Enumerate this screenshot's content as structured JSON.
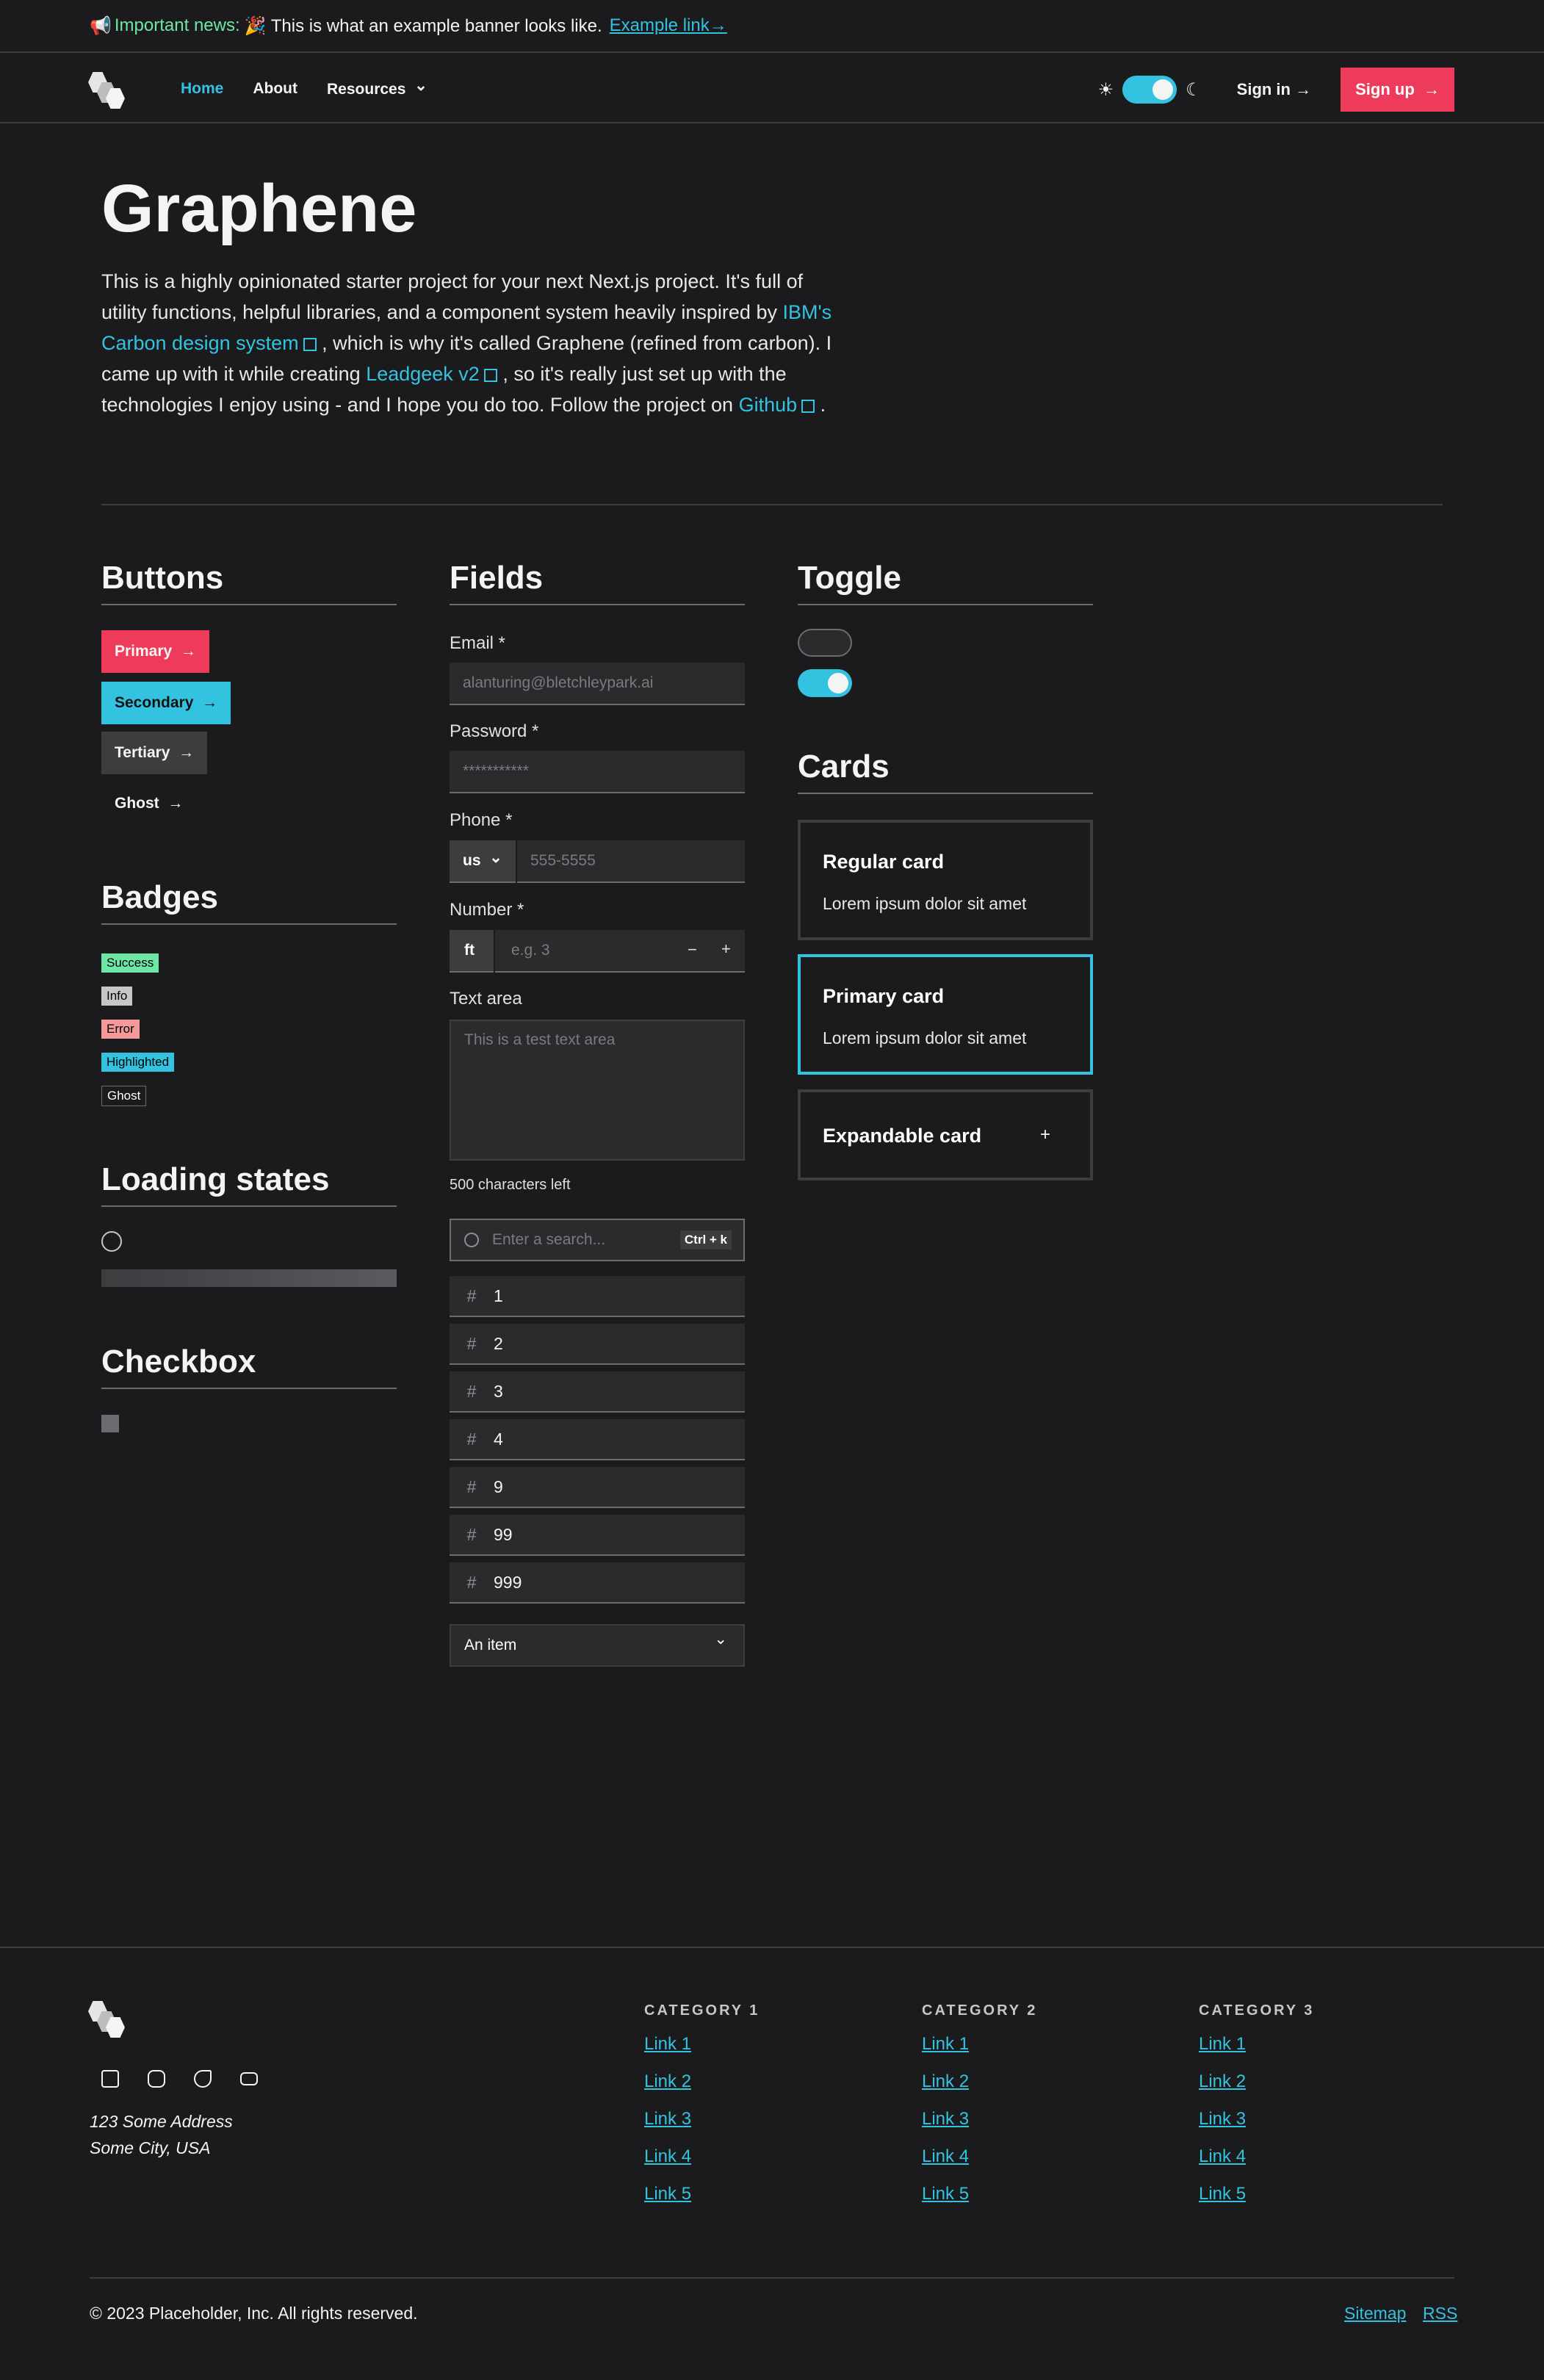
{
  "banner": {
    "emoji": "📢",
    "news_label": "Important news:",
    "message": "🎉 This is what an example banner looks like.",
    "link_label": "Example link",
    "arrow": "→"
  },
  "nav": {
    "links": [
      "Home",
      "About",
      "Resources"
    ],
    "sun_icon": "☀",
    "moon_icon": "☾",
    "signin": "Sign in",
    "signup": "Sign up",
    "arrow": "→",
    "chevron": "⌄"
  },
  "hero": {
    "title": "Graphene",
    "t1": "This is a highly opinionated starter project for your next Next.js project. It's full of utility functions, helpful libraries, and a component system heavily inspired by",
    "link1": "IBM's Carbon design system",
    "t2": ", which is why it's called Graphene (refined from carbon). I came up with it while creating",
    "link2": "Leadgeek v2",
    "t3": ", so it's really just set up with the technologies I enjoy using - and I hope you do too. Follow the project on",
    "link3": "Github",
    "t4": "."
  },
  "buttons": {
    "heading": "Buttons",
    "primary": "Primary",
    "secondary": "Secondary",
    "tertiary": "Tertiary",
    "ghost": "Ghost",
    "arrow": "→"
  },
  "badges": {
    "heading": "Badges",
    "items": [
      "Success",
      "Info",
      "Error",
      "Highlighted",
      "Ghost"
    ]
  },
  "loading": {
    "heading": "Loading states"
  },
  "checkbox": {
    "heading": "Checkbox"
  },
  "fields": {
    "heading": "Fields",
    "email_label": "Email *",
    "email_placeholder": "alanturing@bletchleypark.ai",
    "password_label": "Password *",
    "password_placeholder": "***********",
    "phone_label": "Phone *",
    "phone_country": "us",
    "phone_placeholder": "555-5555",
    "number_label": "Number *",
    "number_unit": "ft",
    "number_placeholder": "e.g. 3",
    "minus": "−",
    "plus": "+",
    "textarea_label": "Text area",
    "textarea_placeholder": "This is a test text area",
    "chars_left": "500 characters left",
    "search_placeholder": "Enter a search...",
    "search_shortcut": "Ctrl + k",
    "number_list": [
      "1",
      "2",
      "3",
      "4",
      "9",
      "99",
      "999"
    ],
    "hash": "#",
    "select_value": "An item"
  },
  "toggle": {
    "heading": "Toggle"
  },
  "cards": {
    "heading": "Cards",
    "regular_title": "Regular card",
    "regular_body": "Lorem ipsum dolor sit amet",
    "primary_title": "Primary card",
    "primary_body": "Lorem ipsum dolor sit amet",
    "expandable_title": "Expandable card",
    "expand_icon": "+"
  },
  "footer": {
    "address_line1": "123 Some Address",
    "address_line2": "Some City, USA",
    "categories": [
      {
        "title": "CATEGORY 1",
        "links": [
          "Link 1",
          "Link 2",
          "Link 3",
          "Link 4",
          "Link 5"
        ]
      },
      {
        "title": "CATEGORY 2",
        "links": [
          "Link 1",
          "Link 2",
          "Link 3",
          "Link 4",
          "Link 5"
        ]
      },
      {
        "title": "CATEGORY 3",
        "links": [
          "Link 1",
          "Link 2",
          "Link 3",
          "Link 4",
          "Link 5"
        ]
      }
    ],
    "copyright": "© 2023 Placeholder, Inc. All rights reserved.",
    "sitemap": "Sitemap",
    "rss": "RSS"
  },
  "colors": {
    "background": "#1b1b1d",
    "primary": "#ee3b5b",
    "accent": "#33c3e0",
    "tertiary": "#3d3d40"
  }
}
